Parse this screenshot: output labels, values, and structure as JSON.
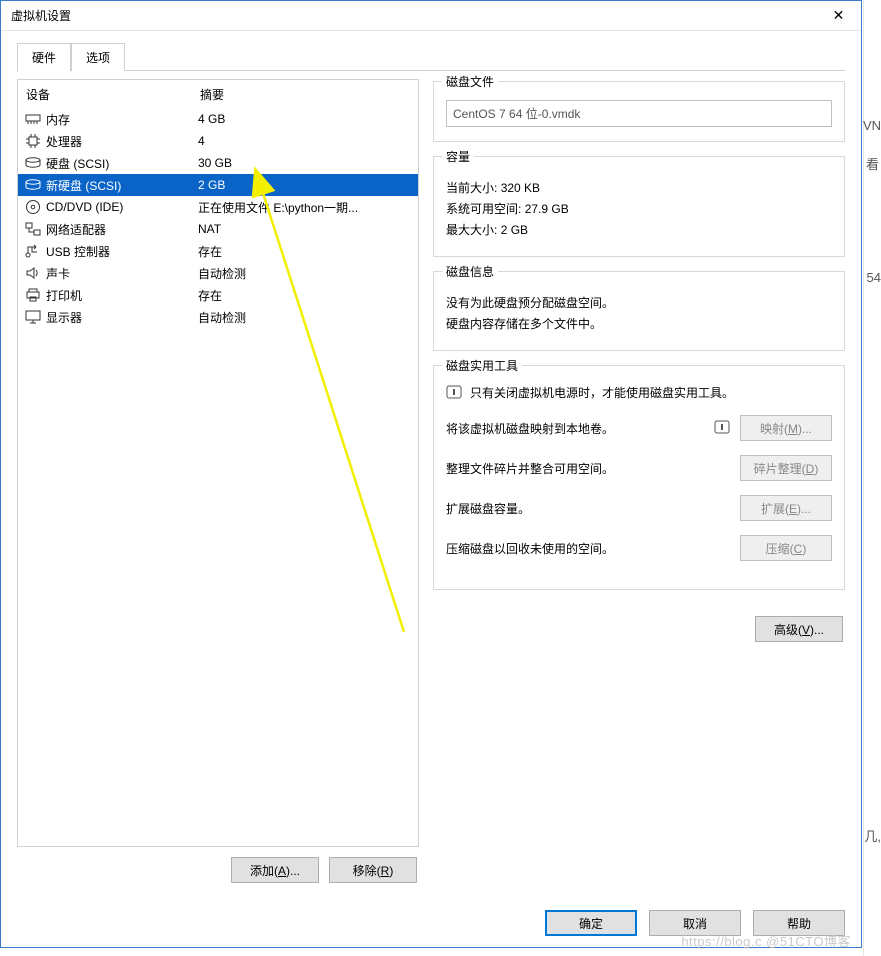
{
  "window": {
    "title": "虚拟机设置",
    "close_glyph": "✕"
  },
  "tabs": {
    "hardware": "硬件",
    "options": "选项"
  },
  "list_header": {
    "device": "设备",
    "summary": "摘要"
  },
  "devices": [
    {
      "icon": "memory-icon",
      "label": "内存",
      "value": "4 GB",
      "selected": false
    },
    {
      "icon": "cpu-icon",
      "label": "处理器",
      "value": "4",
      "selected": false
    },
    {
      "icon": "disk-icon",
      "label": "硬盘 (SCSI)",
      "value": "30 GB",
      "selected": false
    },
    {
      "icon": "disk-icon",
      "label": "新硬盘 (SCSI)",
      "value": "2 GB",
      "selected": true
    },
    {
      "icon": "cd-icon",
      "label": "CD/DVD (IDE)",
      "value": "正在使用文件 E:\\python一期...",
      "selected": false
    },
    {
      "icon": "network-icon",
      "label": "网络适配器",
      "value": "NAT",
      "selected": false
    },
    {
      "icon": "usb-icon",
      "label": "USB 控制器",
      "value": "存在",
      "selected": false
    },
    {
      "icon": "sound-icon",
      "label": "声卡",
      "value": "自动检测",
      "selected": false
    },
    {
      "icon": "printer-icon",
      "label": "打印机",
      "value": "存在",
      "selected": false
    },
    {
      "icon": "display-icon",
      "label": "显示器",
      "value": "自动检测",
      "selected": false
    }
  ],
  "left_buttons": {
    "add": {
      "text": "添加(",
      "key": "A",
      "suffix": ")..."
    },
    "remove": {
      "text": "移除(",
      "key": "R",
      "suffix": ")"
    }
  },
  "right": {
    "disk_file": {
      "legend": "磁盘文件",
      "value": "CentOS 7 64 位-0.vmdk"
    },
    "capacity": {
      "legend": "容量",
      "current_size_label": "当前大小:",
      "current_size_value": "320 KB",
      "free_label": "系统可用空间:",
      "free_value": "27.9 GB",
      "max_label": "最大大小:",
      "max_value": "2 GB"
    },
    "disk_info": {
      "legend": "磁盘信息",
      "line1": "没有为此硬盘预分配磁盘空间。",
      "line2": "硬盘内容存储在多个文件中。"
    },
    "utilities": {
      "legend": "磁盘实用工具",
      "note": "只有关闭虚拟机电源时，才能使用磁盘实用工具。",
      "map_desc": "将该虚拟机磁盘映射到本地卷。",
      "map_btn": {
        "text": "映射(",
        "key": "M",
        "suffix": ")..."
      },
      "defrag_desc": "整理文件碎片并整合可用空间。",
      "defrag_btn": {
        "text": "碎片整理(",
        "key": "D",
        "suffix": ")"
      },
      "expand_desc": "扩展磁盘容量。",
      "expand_btn": {
        "text": "扩展(",
        "key": "E",
        "suffix": ")..."
      },
      "compact_desc": "压缩磁盘以回收未使用的空间。",
      "compact_btn": {
        "text": "压缩(",
        "key": "C",
        "suffix": ")"
      }
    },
    "advanced_btn": {
      "text": "高级(",
      "key": "V",
      "suffix": ")..."
    }
  },
  "footer": {
    "ok": "确定",
    "cancel": "取消",
    "help": "帮助"
  },
  "backdrop": {
    "t1": "VN",
    "t2": "看",
    "t3": "54",
    "t4": "几,"
  },
  "watermark": "https://blog.c    @51CTO博客"
}
